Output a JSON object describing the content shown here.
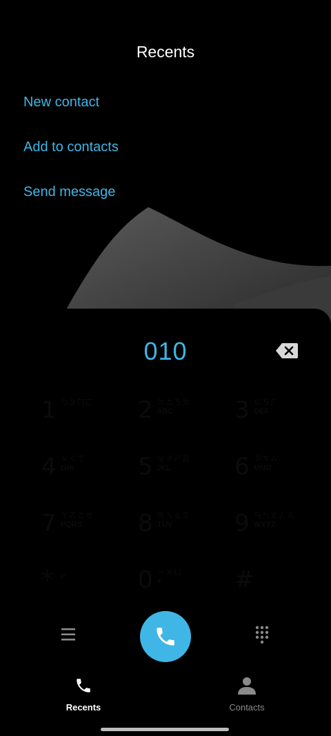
{
  "header": {
    "title": "Recents"
  },
  "menu": {
    "items": [
      {
        "label": "New contact"
      },
      {
        "label": "Add to contacts"
      },
      {
        "label": "Send message"
      }
    ]
  },
  "dialer": {
    "number": "010",
    "keys": [
      {
        "digit": "1",
        "zhuyin": "ㄅㄆㄇㄈ",
        "letters": ""
      },
      {
        "digit": "2",
        "zhuyin": "ㄉㄊㄋㄌ",
        "letters": "ABC"
      },
      {
        "digit": "3",
        "zhuyin": "ㄍㄎㄏ",
        "letters": "DEF"
      },
      {
        "digit": "4",
        "zhuyin": "ㄐㄑㄒ",
        "letters": "GHI"
      },
      {
        "digit": "5",
        "zhuyin": "ㄓㄔㄕㄖ",
        "letters": "JKL"
      },
      {
        "digit": "6",
        "zhuyin": "ㄗㄘㄙ",
        "letters": "MNO"
      },
      {
        "digit": "7",
        "zhuyin": "ㄚㄛㄜㄝ",
        "letters": "PQRS"
      },
      {
        "digit": "8",
        "zhuyin": "ㄞㄟㄠㄡ",
        "letters": "TUV"
      },
      {
        "digit": "9",
        "zhuyin": "ㄢㄣㄤㄥㄦ",
        "letters": "WXYZ"
      },
      {
        "digit": "*",
        "zhuyin": "P",
        "letters": ""
      },
      {
        "digit": "0",
        "zhuyin": "ㄧㄨㄩ",
        "letters": "+"
      },
      {
        "digit": "#",
        "zhuyin": "",
        "letters": ""
      }
    ]
  },
  "bottom_nav": {
    "recents_label": "Recents",
    "contacts_label": "Contacts"
  },
  "colors": {
    "accent": "#3FB6E6",
    "background": "#000000",
    "nav_inactive": "#8a8a8a"
  },
  "icons": [
    "backspace-icon",
    "menu-icon",
    "phone-icon",
    "dialpad-icon",
    "person-icon"
  ]
}
